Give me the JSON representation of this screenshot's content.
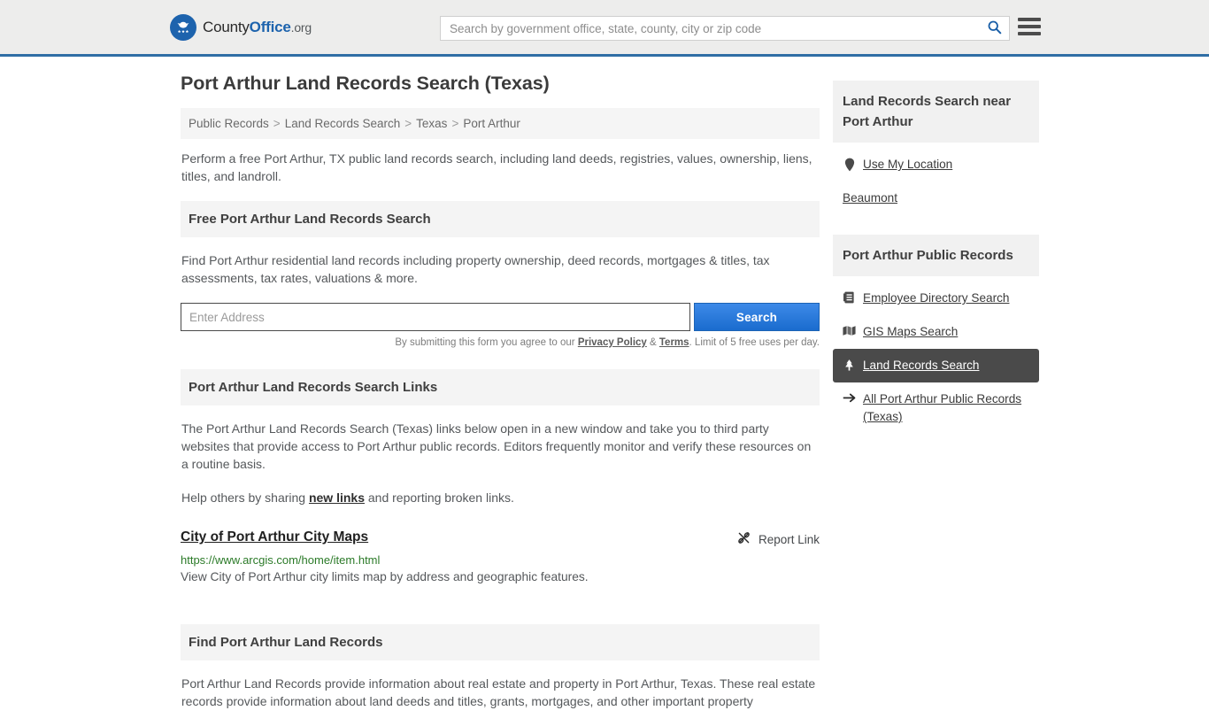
{
  "header": {
    "logo": {
      "icon": "eagle-seal-icon",
      "text_part1": "County",
      "text_part2": "Office",
      "text_part3": ".org"
    },
    "search": {
      "placeholder": "Search by government office, state, county, city or zip code",
      "value": "",
      "submit_icon": "search-icon"
    },
    "menu_icon": "hamburger-menu-icon",
    "accent_color": "#2f6ea5"
  },
  "main": {
    "title": "Port Arthur Land Records Search (Texas)",
    "breadcrumb": [
      "Public Records",
      "Land Records Search",
      "Texas",
      "Port Arthur"
    ],
    "breadcrumb_separator": ">",
    "intro": "Perform a free Port Arthur, TX public land records search, including land deeds, registries, values, ownership, liens, titles, and landroll.",
    "free_search": {
      "heading": "Free Port Arthur Land Records Search",
      "description": "Find Port Arthur residential land records including property ownership, deed records, mortgages & titles, tax assessments, tax rates, valuations & more.",
      "input_placeholder": "Enter Address",
      "input_value": "",
      "button_label": "Search",
      "disclaimer_prefix": "By submitting this form you agree to our ",
      "privacy_policy_label": "Privacy Policy",
      "disclaimer_amp": " & ",
      "terms_label": "Terms",
      "disclaimer_suffix": ". Limit of 5 free uses per day."
    },
    "links_section": {
      "heading": "Port Arthur Land Records Search Links",
      "paragraph": "The Port Arthur Land Records Search (Texas) links below open in a new window and take you to third party websites that provide access to Port Arthur public records. Editors frequently monitor and verify these resources on a routine basis.",
      "help_prefix": "Help others by sharing ",
      "help_link_label": "new links",
      "help_suffix": " and reporting broken links.",
      "results": [
        {
          "title": "City of Port Arthur City Maps",
          "url": "https://www.arcgis.com/home/item.html",
          "description": "View City of Port Arthur city limits map by address and geographic features.",
          "report_label": "Report Link",
          "report_icon": "broken-link-icon"
        }
      ]
    },
    "find_section": {
      "heading": "Find Port Arthur Land Records",
      "paragraph": "Port Arthur Land Records provide information about real estate and property in Port Arthur, Texas. These real estate records provide information about land deeds and titles, grants, mortgages, and other important property"
    }
  },
  "sidebar": {
    "near_section": {
      "heading": "Land Records Search near Port Arthur",
      "items": [
        {
          "label": "Use My Location",
          "icon": "map-pin-icon",
          "active": false
        },
        {
          "label": "Beaumont",
          "icon": "none",
          "active": false
        }
      ]
    },
    "records_section": {
      "heading": "Port Arthur Public Records",
      "items": [
        {
          "label": "Employee Directory Search",
          "icon": "address-book-icon",
          "active": false
        },
        {
          "label": "GIS Maps Search",
          "icon": "folded-map-icon",
          "active": false
        },
        {
          "label": "Land Records Search",
          "icon": "tree-icon",
          "active": true
        },
        {
          "label": "All Port Arthur Public Records (Texas)",
          "icon": "arrow-right-icon",
          "active": false
        }
      ],
      "active_bg": "#4a4a4a"
    }
  }
}
